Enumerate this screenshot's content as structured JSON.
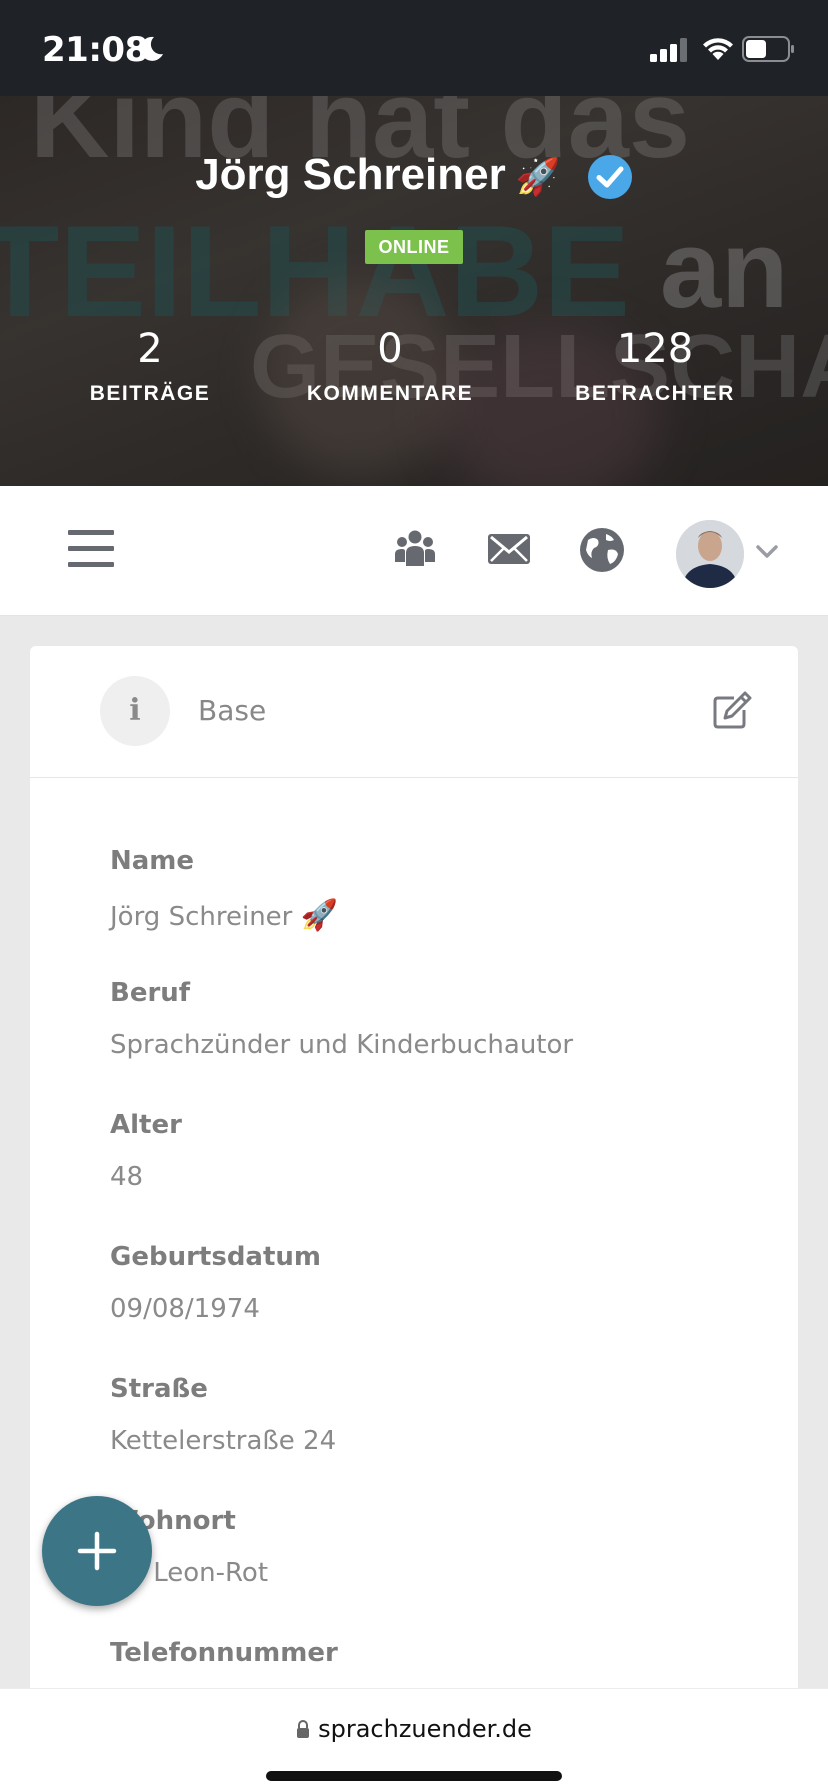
{
  "status_bar": {
    "time": "21:08",
    "icons": [
      "moon-icon",
      "signal-icon",
      "wifi-icon",
      "battery-icon"
    ]
  },
  "profile": {
    "name": "Jörg Schreiner",
    "name_emoji": "🚀",
    "verified_icon": "verified-check-icon",
    "status_badge": "ONLINE",
    "background_text": [
      "Kind hat das",
      "TEILHABE",
      "an",
      "GESELLSCHAFT"
    ],
    "stats": [
      {
        "value": "2",
        "label": "BEITRÄGE"
      },
      {
        "value": "0",
        "label": "KOMMENTARE"
      },
      {
        "value": "128",
        "label": "BETRACHTER"
      }
    ]
  },
  "navbar": {
    "icons": [
      "menu-icon",
      "groups-icon",
      "mail-icon",
      "globe-icon",
      "chevron-down-icon"
    ]
  },
  "card": {
    "title": "Base",
    "info_glyph": "i",
    "fields": [
      {
        "label": "Name",
        "value": "Jörg Schreiner",
        "emoji": "🚀"
      },
      {
        "label": "Beruf",
        "value": "Sprachzünder und Kinderbuchautor"
      },
      {
        "label": "Alter",
        "value": "48"
      },
      {
        "label": "Geburtsdatum",
        "value": "09/08/1974"
      },
      {
        "label": "Straße",
        "value": "Kettelerstraße 24"
      },
      {
        "label": "Wohnort",
        "value": "St. Leon-Rot"
      },
      {
        "label": "Telefonnummer",
        "value": ""
      }
    ]
  },
  "browser": {
    "url": "sprachzuender.de"
  },
  "colors": {
    "status_bar_bg": "#1f2227",
    "online_green": "#7cc14b",
    "verified_blue": "#4aa8e8",
    "fab_teal": "#3c7585",
    "page_bg": "#e9e9e9"
  }
}
